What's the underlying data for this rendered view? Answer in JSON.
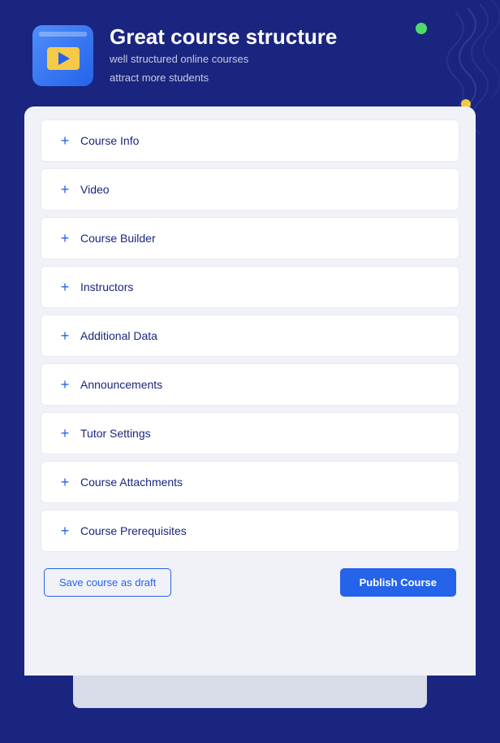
{
  "header": {
    "title": "Great course structure",
    "subtitle_line1": "well structured online courses",
    "subtitle_line2": "attract more students"
  },
  "accordion": {
    "items": [
      {
        "id": "course-info",
        "label": "Course Info"
      },
      {
        "id": "video",
        "label": "Video"
      },
      {
        "id": "course-builder",
        "label": "Course Builder"
      },
      {
        "id": "instructors",
        "label": "Instructors"
      },
      {
        "id": "additional-data",
        "label": "Additional Data"
      },
      {
        "id": "announcements",
        "label": "Announcements"
      },
      {
        "id": "tutor-settings",
        "label": "Tutor Settings"
      },
      {
        "id": "course-attachments",
        "label": "Course Attachments"
      },
      {
        "id": "course-prerequisites",
        "label": "Course Prerequisites"
      }
    ],
    "plus_icon": "+"
  },
  "buttons": {
    "draft_label": "Save course as draft",
    "publish_label": "Publish Course"
  },
  "colors": {
    "background": "#1a2580",
    "accent": "#2563eb",
    "dot_green": "#4cdb6b",
    "dot_yellow": "#f5c842"
  }
}
